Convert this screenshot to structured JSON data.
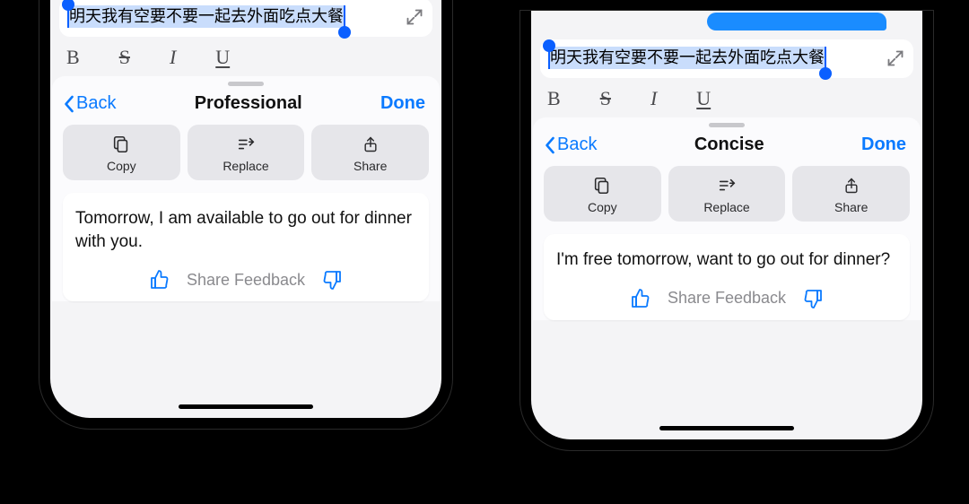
{
  "phones": [
    {
      "selected_text": "明天我有空要不要一起去外面吃点大餐",
      "format": {
        "bold": "B",
        "strike": "S",
        "italic": "I",
        "underline": "U"
      },
      "sheet": {
        "back_label": "Back",
        "title": "Professional",
        "done_label": "Done",
        "actions": {
          "copy": "Copy",
          "replace": "Replace",
          "share": "Share"
        },
        "result": "Tomorrow, I am available to go out for dinner with you.",
        "feedback_label": "Share Feedback"
      }
    },
    {
      "selected_text": "明天我有空要不要一起去外面吃点大餐",
      "format": {
        "bold": "B",
        "strike": "S",
        "italic": "I",
        "underline": "U"
      },
      "sheet": {
        "back_label": "Back",
        "title": "Concise",
        "done_label": "Done",
        "actions": {
          "copy": "Copy",
          "replace": "Replace",
          "share": "Share"
        },
        "result": "I'm free tomorrow, want to go out for dinner?",
        "feedback_label": "Share Feedback"
      }
    }
  ]
}
